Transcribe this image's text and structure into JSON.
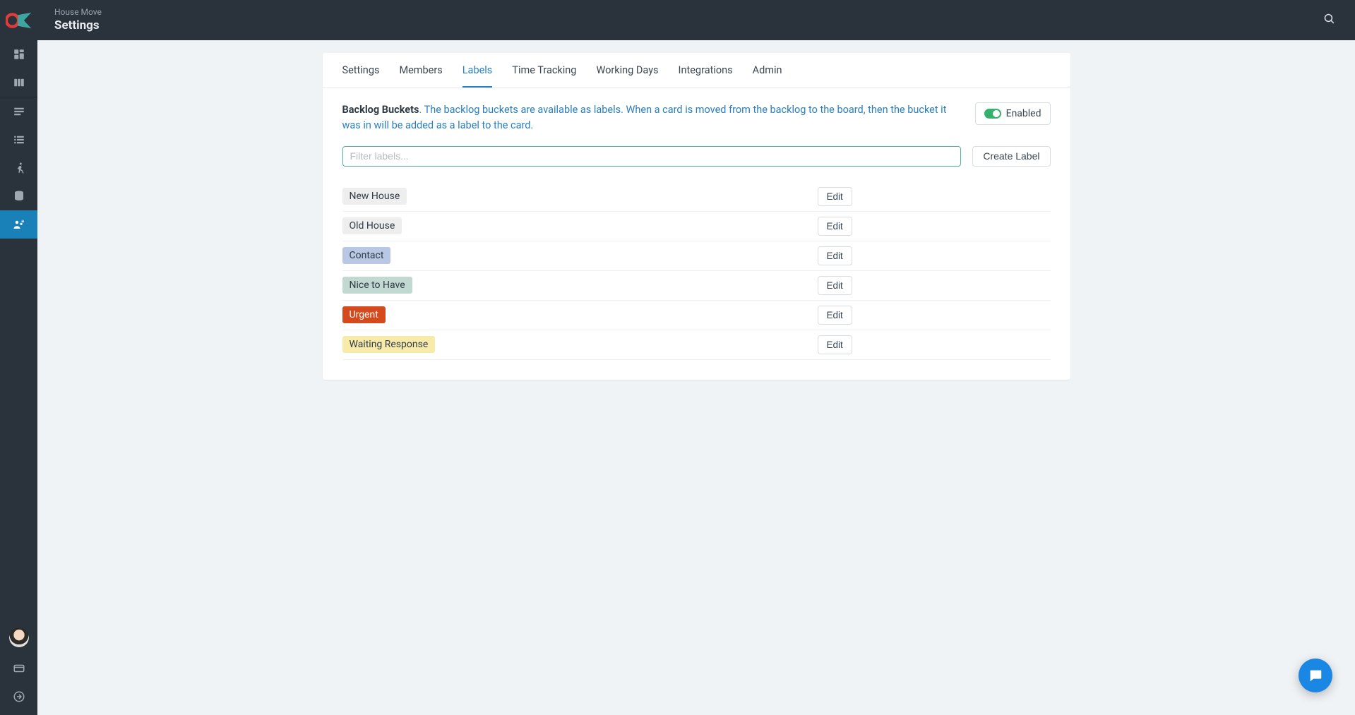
{
  "header": {
    "breadcrumb": "House Move",
    "title": "Settings"
  },
  "tabs": [
    {
      "label": "Settings",
      "active": false
    },
    {
      "label": "Members",
      "active": false
    },
    {
      "label": "Labels",
      "active": true
    },
    {
      "label": "Time Tracking",
      "active": false
    },
    {
      "label": "Working Days",
      "active": false
    },
    {
      "label": "Integrations",
      "active": false
    },
    {
      "label": "Admin",
      "active": false
    }
  ],
  "backlog": {
    "bold": "Backlog Buckets",
    "description": ". The backlog buckets are available as labels. When a card is moved from the backlog to the board, then the bucket it was in will be added as a label to the card.",
    "toggle_label": "Enabled"
  },
  "filter": {
    "placeholder": "Filter labels...",
    "create_label": "Create Label"
  },
  "edit_label": "Edit",
  "labels": [
    {
      "name": "New House",
      "bg": "#eeeeee",
      "fg": "#2f3b45"
    },
    {
      "name": "Old House",
      "bg": "#eeeeee",
      "fg": "#2f3b45"
    },
    {
      "name": "Contact",
      "bg": "#b8c7e4",
      "fg": "#2f3b45"
    },
    {
      "name": "Nice to Have",
      "bg": "#c2d9d1",
      "fg": "#2f3b45"
    },
    {
      "name": "Urgent",
      "bg": "#d54a1d",
      "fg": "#ffffff"
    },
    {
      "name": "Waiting Response",
      "bg": "#f8eaa9",
      "fg": "#2f3b45"
    }
  ]
}
